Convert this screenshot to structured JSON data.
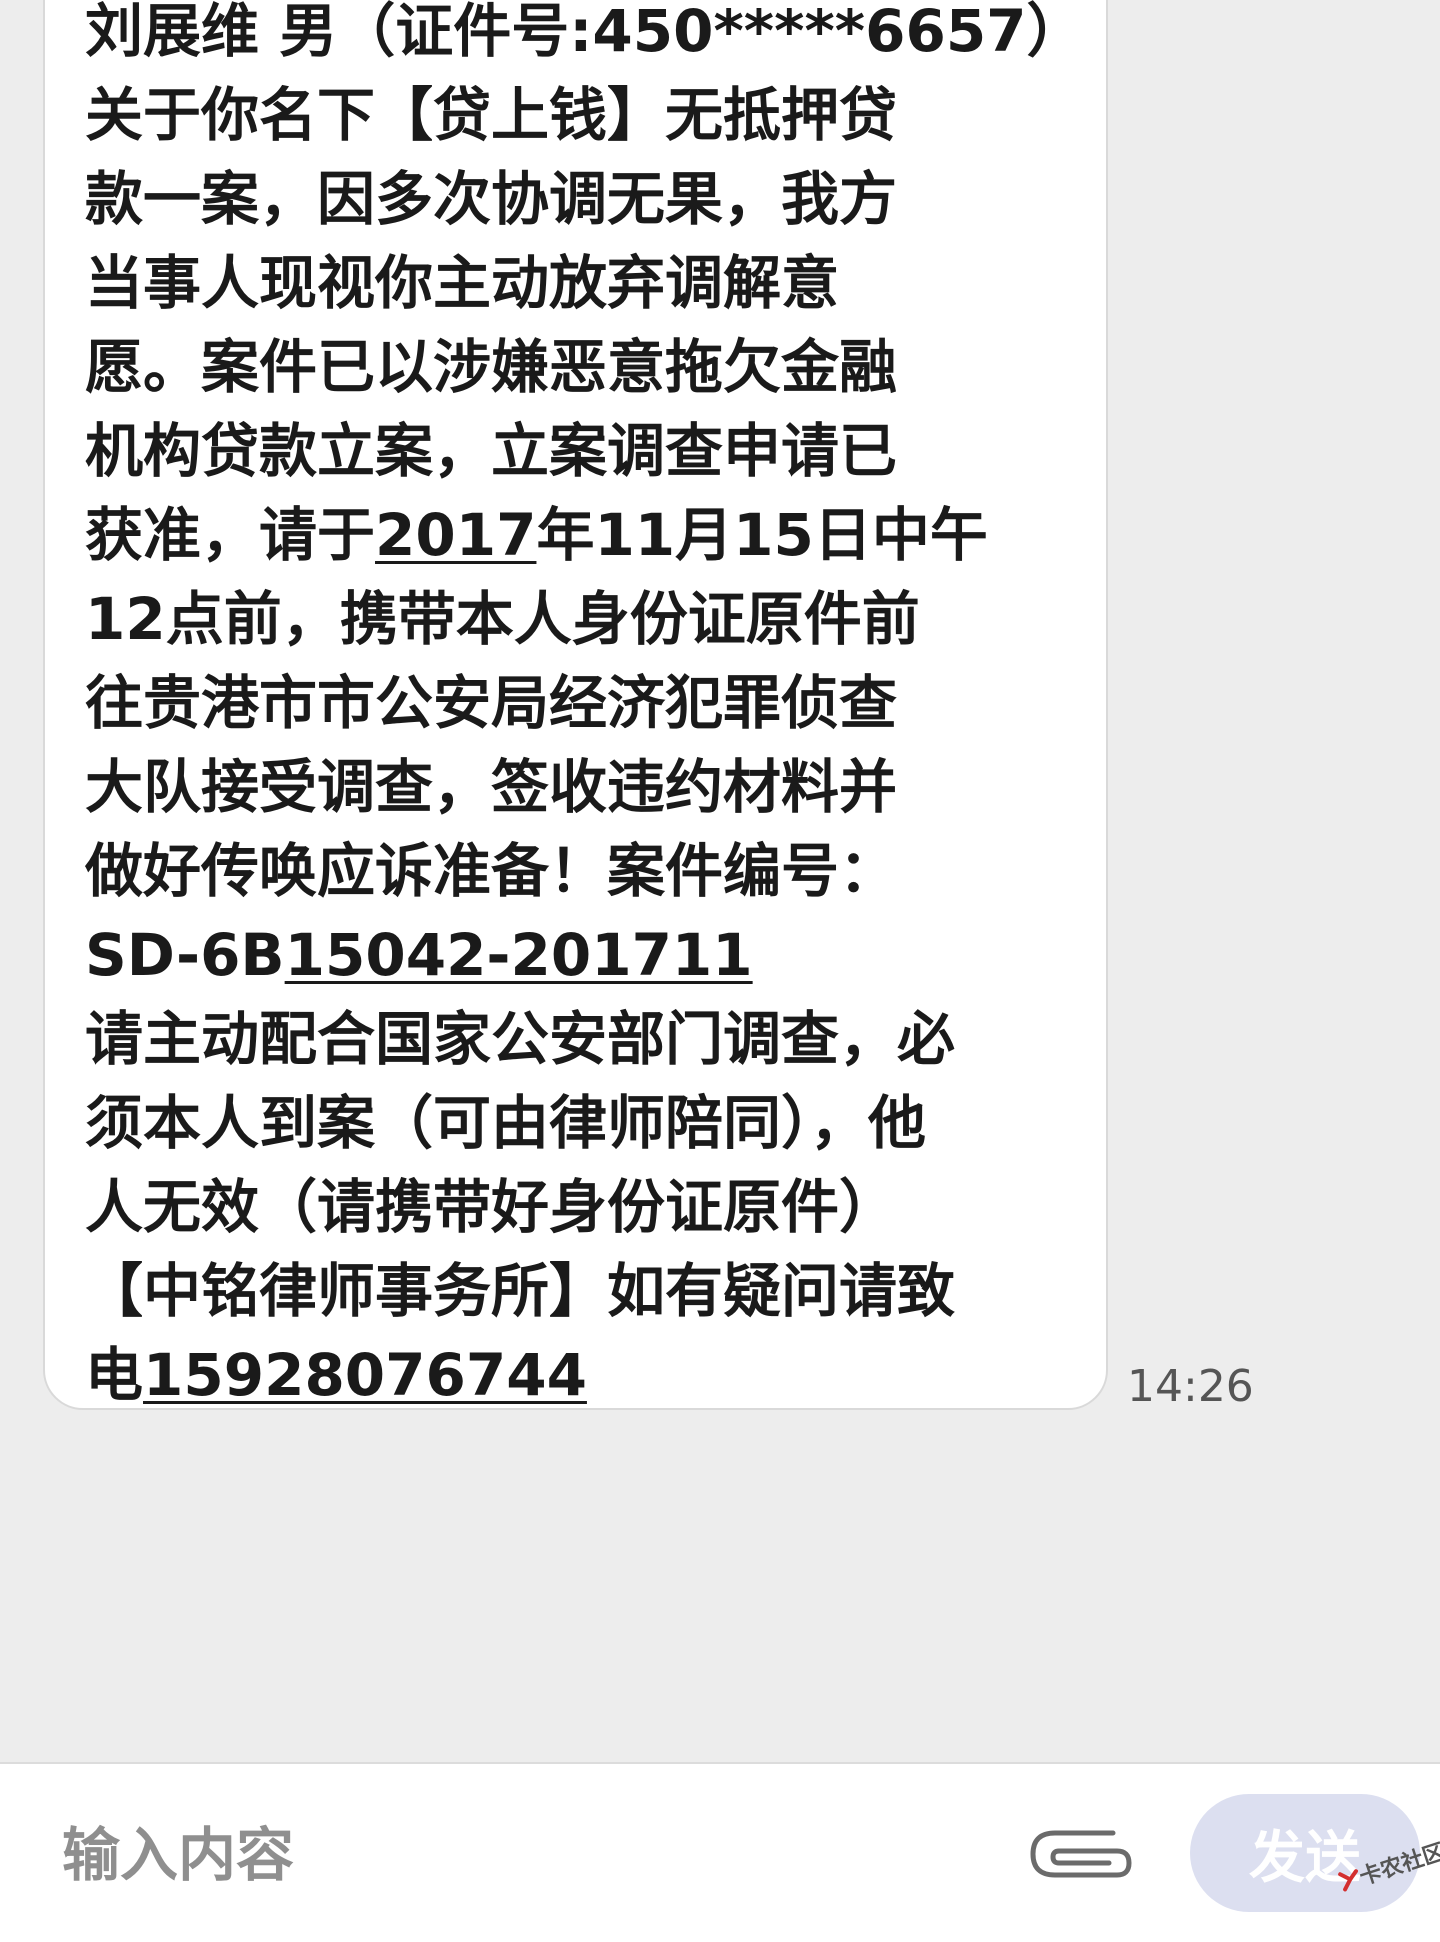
{
  "message": {
    "lines": [
      "刘展维 男（证件号:450*****6657）",
      "关于你名下【贷上钱】无抵押贷",
      "款一案，因多次协调无果，我方",
      "当事人现视你主动放弃调解意",
      "愿。案件已以涉嫌恶意拖欠金融",
      "机构贷款立案，立案调查申请已"
    ],
    "line7_pre": "获准，请于",
    "line7_link": "2017",
    "line7_post": "年11月15日中午",
    "lines_b": [
      "12点前，携带本人身份证原件前",
      "往贵港市市公安局经济犯罪侦查",
      "大队接受调查，签收违约材料并",
      "做好传唤应诉准备！案件编号："
    ],
    "case_pre": "SD-6B",
    "case_link": "15042-201711",
    "lines_c": [
      "请主动配合国家公安部门调查，必",
      "须本人到案（可由律师陪同），他",
      "人无效（请携带好身份证原件）",
      "【中铭律师事务所】如有疑问请致"
    ],
    "phone_pre": "电",
    "phone_link": "15928076744",
    "time": "14:26"
  },
  "input": {
    "placeholder": "输入内容"
  },
  "send_button": {
    "label": "发送"
  },
  "watermark": {
    "text": "卡农社区"
  },
  "colors": {
    "background": "#ededed",
    "bubble": "#ffffff",
    "send_button": "#dcdff0"
  },
  "icons": {
    "attach": "paperclip-icon"
  }
}
